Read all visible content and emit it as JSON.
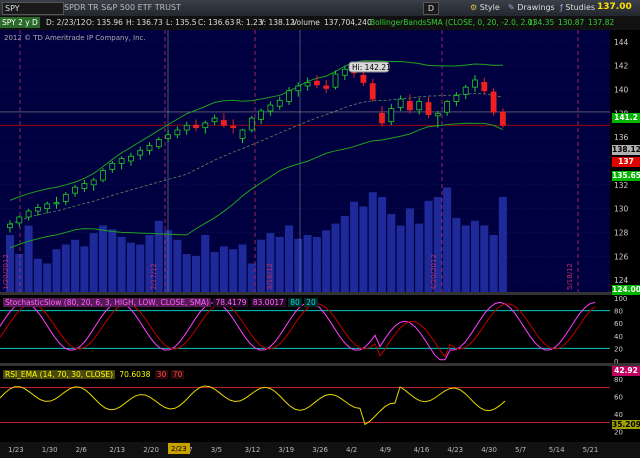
{
  "toolbar": {
    "symbol": "SPY",
    "description": "SPDR TR S&P 500 ETF TRUST",
    "d_button": "D",
    "style": "Style",
    "drawings": "Drawings",
    "studies": "Studies",
    "last_price": "137.00"
  },
  "statusbar": {
    "symbol_period": "SPY 2 y D",
    "date": "D: 2/23/12",
    "open": "O: 135.96",
    "high": "H: 136.73",
    "low": "L: 135.5",
    "close": "C: 136.63",
    "range": "R: 1.23",
    "typical": "Y: 138.12",
    "volume_label": "Volume",
    "volume": "137,704,240",
    "bb_label": "BollingerBandsSMA (CLOSE, 0, 20, -2.0, 2.0)",
    "bb_values": [
      "134.35",
      "130.87",
      "137.82"
    ],
    "copyright": "2012 © TD Ameritrade IP Company, Inc."
  },
  "main_panel": {
    "price_axis": [
      "144",
      "142",
      "140",
      "138",
      "136",
      "134",
      "132",
      "130",
      "128",
      "126",
      "124"
    ],
    "hi_bubble": "Hi: 142.21",
    "price_tags": [
      {
        "value": "141.2",
        "color": "#00b400"
      },
      {
        "value": "138.12",
        "color": "#b0b0b0"
      },
      {
        "value": "137",
        "color": "#e00000"
      },
      {
        "value": "135.65",
        "color": "#00b400"
      },
      {
        "value": "124.00",
        "color": "#00b400"
      }
    ],
    "vertical_dates": [
      "1/20/2012",
      "2/17/12",
      "3/16/12",
      "4/20/2012",
      "5/18/12"
    ]
  },
  "stochastic_panel": {
    "label": "StochasticSlow (80, 20, 6, 3, HIGH, LOW, CLOSE, SMA)",
    "values": [
      "78.4179",
      "83.0017",
      "80",
      "20"
    ],
    "value_colors": [
      "#ff40ff",
      "#ff40ff",
      "#00e0e0",
      "#00e0e0"
    ],
    "axis": [
      "100",
      "80",
      "60",
      "40",
      "20",
      "0"
    ],
    "tag": "42.92"
  },
  "rsi_panel": {
    "label": "RSI_EMA (14, 70, 30, CLOSE)",
    "value": "70.6038",
    "levels": [
      "30",
      "70"
    ],
    "axis": [
      "80",
      "60",
      "40",
      "20"
    ],
    "tag": "35.209"
  },
  "time_axis": {
    "labels": [
      "1/23",
      "1/30",
      "2/6",
      "2/13",
      "2/20",
      "2/27",
      "3/5",
      "3/12",
      "3/19",
      "3/26",
      "4/2",
      "4/9",
      "4/16",
      "4/23",
      "4/30",
      "5/7",
      "5/14",
      "5/21"
    ],
    "cursor_label": "2/23"
  },
  "chart_data": {
    "type": "candlestick",
    "symbol": "SPY",
    "period": "D",
    "ohlc_approx": [
      [
        128.4,
        129.0,
        128.0,
        128.7
      ],
      [
        128.8,
        129.4,
        128.5,
        129.3
      ],
      [
        129.3,
        130.0,
        129.0,
        129.8
      ],
      [
        129.8,
        130.4,
        129.4,
        130.1
      ],
      [
        130.0,
        130.6,
        129.6,
        130.4
      ],
      [
        130.4,
        131.0,
        130.0,
        130.5
      ],
      [
        130.6,
        131.4,
        130.3,
        131.2
      ],
      [
        131.3,
        132.0,
        131.0,
        131.8
      ],
      [
        131.7,
        132.4,
        131.4,
        132.1
      ],
      [
        132.0,
        132.6,
        131.5,
        132.4
      ],
      [
        132.4,
        133.4,
        132.2,
        133.2
      ],
      [
        133.3,
        134.0,
        133.0,
        133.8
      ],
      [
        133.8,
        134.4,
        133.3,
        134.2
      ],
      [
        134.0,
        134.7,
        133.6,
        134.4
      ],
      [
        134.5,
        135.2,
        134.1,
        134.9
      ],
      [
        134.9,
        135.6,
        134.5,
        135.3
      ],
      [
        135.2,
        136.0,
        135.0,
        135.8
      ],
      [
        135.9,
        136.6,
        135.6,
        136.2
      ],
      [
        136.2,
        136.9,
        135.9,
        136.6
      ],
      [
        136.6,
        137.3,
        136.2,
        137.0
      ],
      [
        137.0,
        137.5,
        136.5,
        136.8
      ],
      [
        136.8,
        137.4,
        136.3,
        137.2
      ],
      [
        137.3,
        137.9,
        137.0,
        137.6
      ],
      [
        137.4,
        138.0,
        136.8,
        137.0
      ],
      [
        136.9,
        137.5,
        136.3,
        136.8
      ],
      [
        135.9,
        136.7,
        135.5,
        136.6
      ],
      [
        136.6,
        137.8,
        136.4,
        137.6
      ],
      [
        137.5,
        138.4,
        137.1,
        138.2
      ],
      [
        138.2,
        139.0,
        137.8,
        138.7
      ],
      [
        138.6,
        139.4,
        138.3,
        139.1
      ],
      [
        139.0,
        140.2,
        138.7,
        139.9
      ],
      [
        139.9,
        140.6,
        139.4,
        140.3
      ],
      [
        140.3,
        141.0,
        139.9,
        140.6
      ],
      [
        140.7,
        141.2,
        140.1,
        140.4
      ],
      [
        140.3,
        140.8,
        139.7,
        140.1
      ],
      [
        140.2,
        141.6,
        140.0,
        141.3
      ],
      [
        141.2,
        142.0,
        140.8,
        141.7
      ],
      [
        141.6,
        142.21,
        141.0,
        141.4
      ],
      [
        141.2,
        141.6,
        140.3,
        140.6
      ],
      [
        140.5,
        140.9,
        139.0,
        139.2
      ],
      [
        138.0,
        138.6,
        136.9,
        137.2
      ],
      [
        137.3,
        138.8,
        137.0,
        138.4
      ],
      [
        138.5,
        139.5,
        138.2,
        139.2
      ],
      [
        139.0,
        139.6,
        138.0,
        138.3
      ],
      [
        138.3,
        139.3,
        137.9,
        139.0
      ],
      [
        138.9,
        139.4,
        137.6,
        137.9
      ],
      [
        137.8,
        138.2,
        136.8,
        138.0
      ],
      [
        138.1,
        139.1,
        137.8,
        139.0
      ],
      [
        139.0,
        139.8,
        138.6,
        139.5
      ],
      [
        139.6,
        140.4,
        139.2,
        140.2
      ],
      [
        140.2,
        141.2,
        139.8,
        140.8
      ],
      [
        140.6,
        141.0,
        139.6,
        139.9
      ],
      [
        139.8,
        140.1,
        137.8,
        138.1
      ],
      [
        138.1,
        138.4,
        136.8,
        137.0
      ]
    ],
    "price_range": [
      123,
      145
    ]
  }
}
